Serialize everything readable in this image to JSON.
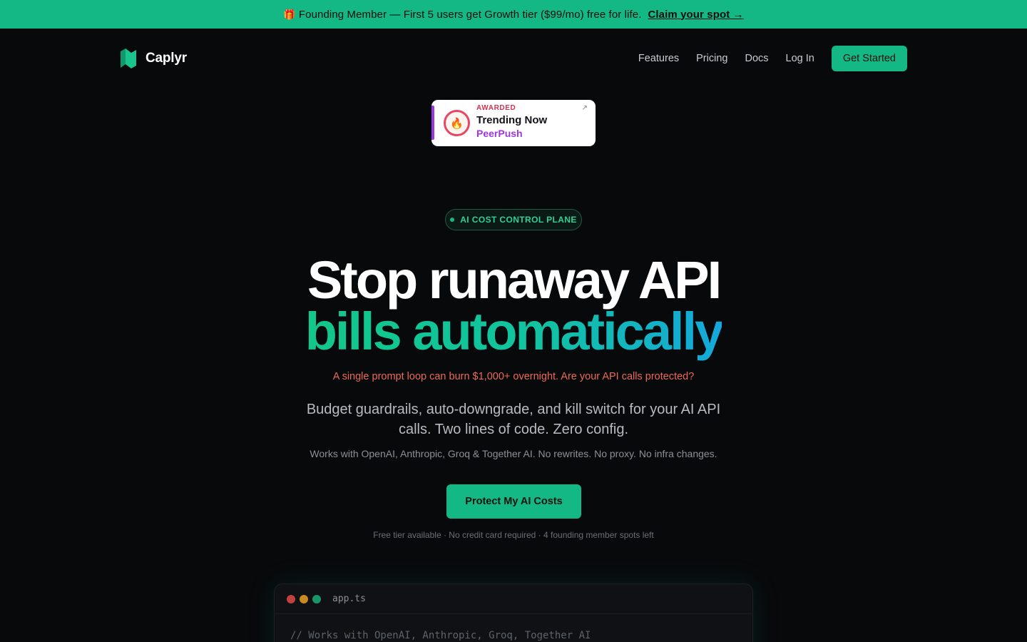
{
  "banner": {
    "gift_icon": "🎁",
    "text": "Founding Member — First 5 users get Growth tier ($99/mo) free for life.",
    "claim_label": "Claim your spot →"
  },
  "nav": {
    "brand": "Caplyr",
    "links": [
      "Features",
      "Pricing",
      "Docs",
      "Log In"
    ],
    "cta_label": "Get Started"
  },
  "award": {
    "kicker": "AWARDED",
    "title": "Trending Now",
    "source": "PeerPush",
    "badge_icon": "🔥",
    "arrow_icon": "↗"
  },
  "hero": {
    "pill": "AI COST CONTROL PLANE",
    "headline_line1": "Stop runaway API",
    "headline_line2": "bills automatically",
    "warning": "A single prompt loop can burn $1,000+ overnight. Are your API calls protected?",
    "lead": "Budget guardrails, auto-downgrade, and kill switch for your AI API calls. Two lines of code. Zero config.",
    "compat": "Works with OpenAI, Anthropic, Groq & Together AI. No rewrites. No proxy. No infra changes.",
    "cta_label": "Protect My AI Costs",
    "fine_print": "Free tier available · No credit card required · 4 founding member spots left"
  },
  "code_window": {
    "filename": "app.ts",
    "first_line": "// Works with OpenAI, Anthropic, Groq, Together AI"
  },
  "colors": {
    "accent": "#14b884",
    "background": "#08090b",
    "warning": "#ec6a55",
    "award_purple": "#9b36e6"
  }
}
